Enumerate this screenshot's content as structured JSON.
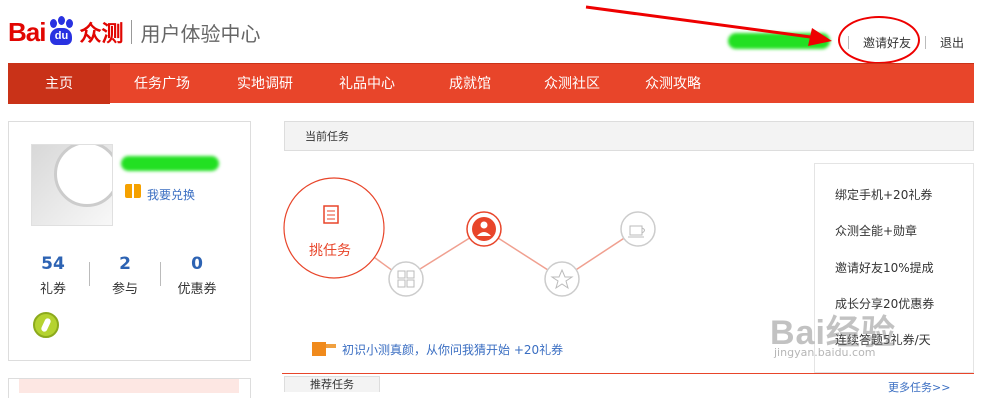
{
  "header": {
    "logo_text": "Bai",
    "logo_paw_text": "du",
    "logo_product": "众测",
    "center_title": "用户体验中心",
    "invite_link": "邀请好友",
    "logout_link": "退出"
  },
  "nav": {
    "items": [
      {
        "label": "主页",
        "active": true
      },
      {
        "label": "任务广场",
        "active": false
      },
      {
        "label": "实地调研",
        "active": false
      },
      {
        "label": "礼品中心",
        "active": false
      },
      {
        "label": "成就馆",
        "active": false
      },
      {
        "label": "众测社区",
        "active": false
      },
      {
        "label": "众测攻略",
        "active": false
      }
    ]
  },
  "profile": {
    "exchange_link": "我要兑换",
    "stats": [
      {
        "value": "54",
        "label": "礼券"
      },
      {
        "value": "2",
        "label": "参与"
      },
      {
        "value": "0",
        "label": "优惠券"
      }
    ]
  },
  "tasks": {
    "current_title": "当前任务",
    "flow_start_label": "挑任务",
    "hint": "初识小测真颜，从你问我猜开始 +20礼券",
    "side_tasks": [
      "绑定手机+20礼券",
      "众测全能+勋章",
      "邀请好友10%提成",
      "成长分享20优惠券",
      "连续答题5礼券/天"
    ],
    "recommended_tab": "推荐任务",
    "more_link": "更多任务>>"
  },
  "watermark": {
    "main": "Bai经验",
    "url": "jingyan.baidu.com"
  },
  "colors": {
    "brand_red": "#e8452a",
    "link_blue": "#3a6ec2",
    "stat_blue": "#2d63b3"
  }
}
